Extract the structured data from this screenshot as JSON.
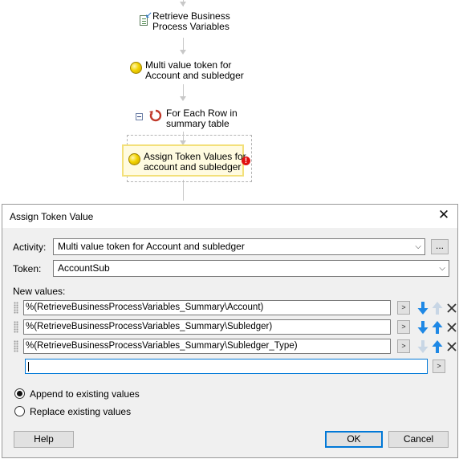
{
  "workflow": {
    "steps": [
      {
        "line1": "Retrieve Business",
        "line2": "Process Variables",
        "icon": "retrieve-variables-icon"
      },
      {
        "line1": "Multi value token for",
        "line2": "Account and subledger",
        "icon": "token-coin-icon"
      },
      {
        "line1": "For Each Row in",
        "line2": "summary table",
        "icon": "loop-icon"
      },
      {
        "line1": "Assign Token Values for",
        "line2": "account and subledger",
        "icon": "token-coin-icon"
      }
    ],
    "error_badge": "!"
  },
  "dialog": {
    "title": "Assign Token Value",
    "close_glyph": "✕",
    "activity_label": "Activity:",
    "activity_value": "Multi value token for Account and subledger",
    "ellipsis_label": "...",
    "token_label": "Token:",
    "token_value": "AccountSub",
    "new_values_label": "New values:",
    "values": [
      {
        "text": "%(RetrieveBusinessProcessVariables_Summary\\Account)",
        "down_enabled": true,
        "up_enabled": false
      },
      {
        "text": "%(RetrieveBusinessProcessVariables_Summary\\Subledger)",
        "down_enabled": true,
        "up_enabled": true
      },
      {
        "text": "%(RetrieveBusinessProcessVariables_Summary\\Subledger_Type)",
        "down_enabled": false,
        "up_enabled": true
      }
    ],
    "insert_glyph": ">",
    "new_value_text": "",
    "radio_append": "Append to existing values",
    "radio_replace": "Replace existing values",
    "selected_option": "append",
    "help_label": "Help",
    "ok_label": "OK",
    "cancel_label": "Cancel"
  },
  "colors": {
    "arrow_enabled": "#1e88e5",
    "arrow_disabled": "#c8d6e5",
    "selection_border": "#f3e07a",
    "accent": "#0078d7"
  }
}
